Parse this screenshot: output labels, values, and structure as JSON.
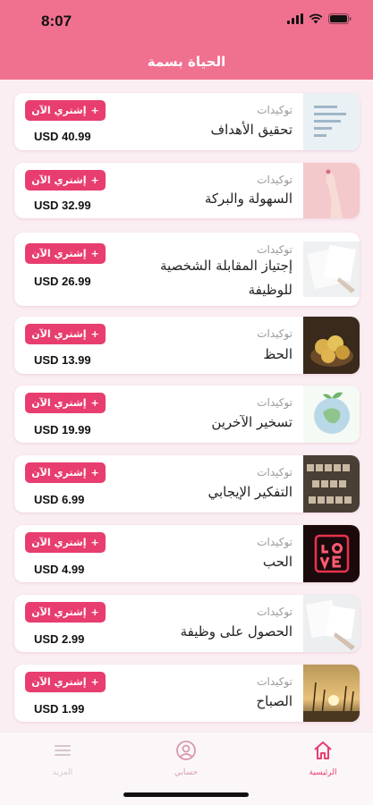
{
  "status": {
    "time": "8:07"
  },
  "header": {
    "title": "الحياة بسمة"
  },
  "products": [
    {
      "category": "توكيدات",
      "title": "تحقيق الأهداف",
      "price": "USD 40.99",
      "button_label": "إشتري الآن"
    },
    {
      "category": "توكيدات",
      "title": "السهولة والبركة",
      "price": "USD 32.99",
      "button_label": "إشتري الآن"
    },
    {
      "category": "توكيدات",
      "title": "إجتياز المقابلة الشخصية للوظيفة",
      "price": "USD 26.99",
      "button_label": "إشتري الآن"
    },
    {
      "category": "توكيدات",
      "title": "الحظ",
      "price": "USD 13.99",
      "button_label": "إشتري الآن"
    },
    {
      "category": "توكيدات",
      "title": "تسخير الآخرين",
      "price": "USD 19.99",
      "button_label": "إشتري الآن"
    },
    {
      "category": "توكيدات",
      "title": "التفكير الإيجابي",
      "price": "USD 6.99",
      "button_label": "إشتري الآن"
    },
    {
      "category": "توكيدات",
      "title": "الحب",
      "price": "USD 4.99",
      "button_label": "إشتري الآن"
    },
    {
      "category": "توكيدات",
      "title": "الحصول على وظيفة",
      "price": "USD 2.99",
      "button_label": "إشتري الآن"
    },
    {
      "category": "توكيدات",
      "title": "الصباح",
      "price": "USD 1.99",
      "button_label": "إشتري الآن"
    }
  ],
  "tabs": [
    {
      "label": "الرئيسية",
      "icon": "home-icon",
      "active": true
    },
    {
      "label": "حسابي",
      "icon": "user-icon",
      "active": false
    },
    {
      "label": "المزيد",
      "icon": "menu-icon",
      "active": false
    }
  ],
  "colors": {
    "accent": "#e83d6f",
    "header": "#f0708f",
    "background": "#fbeef3"
  }
}
